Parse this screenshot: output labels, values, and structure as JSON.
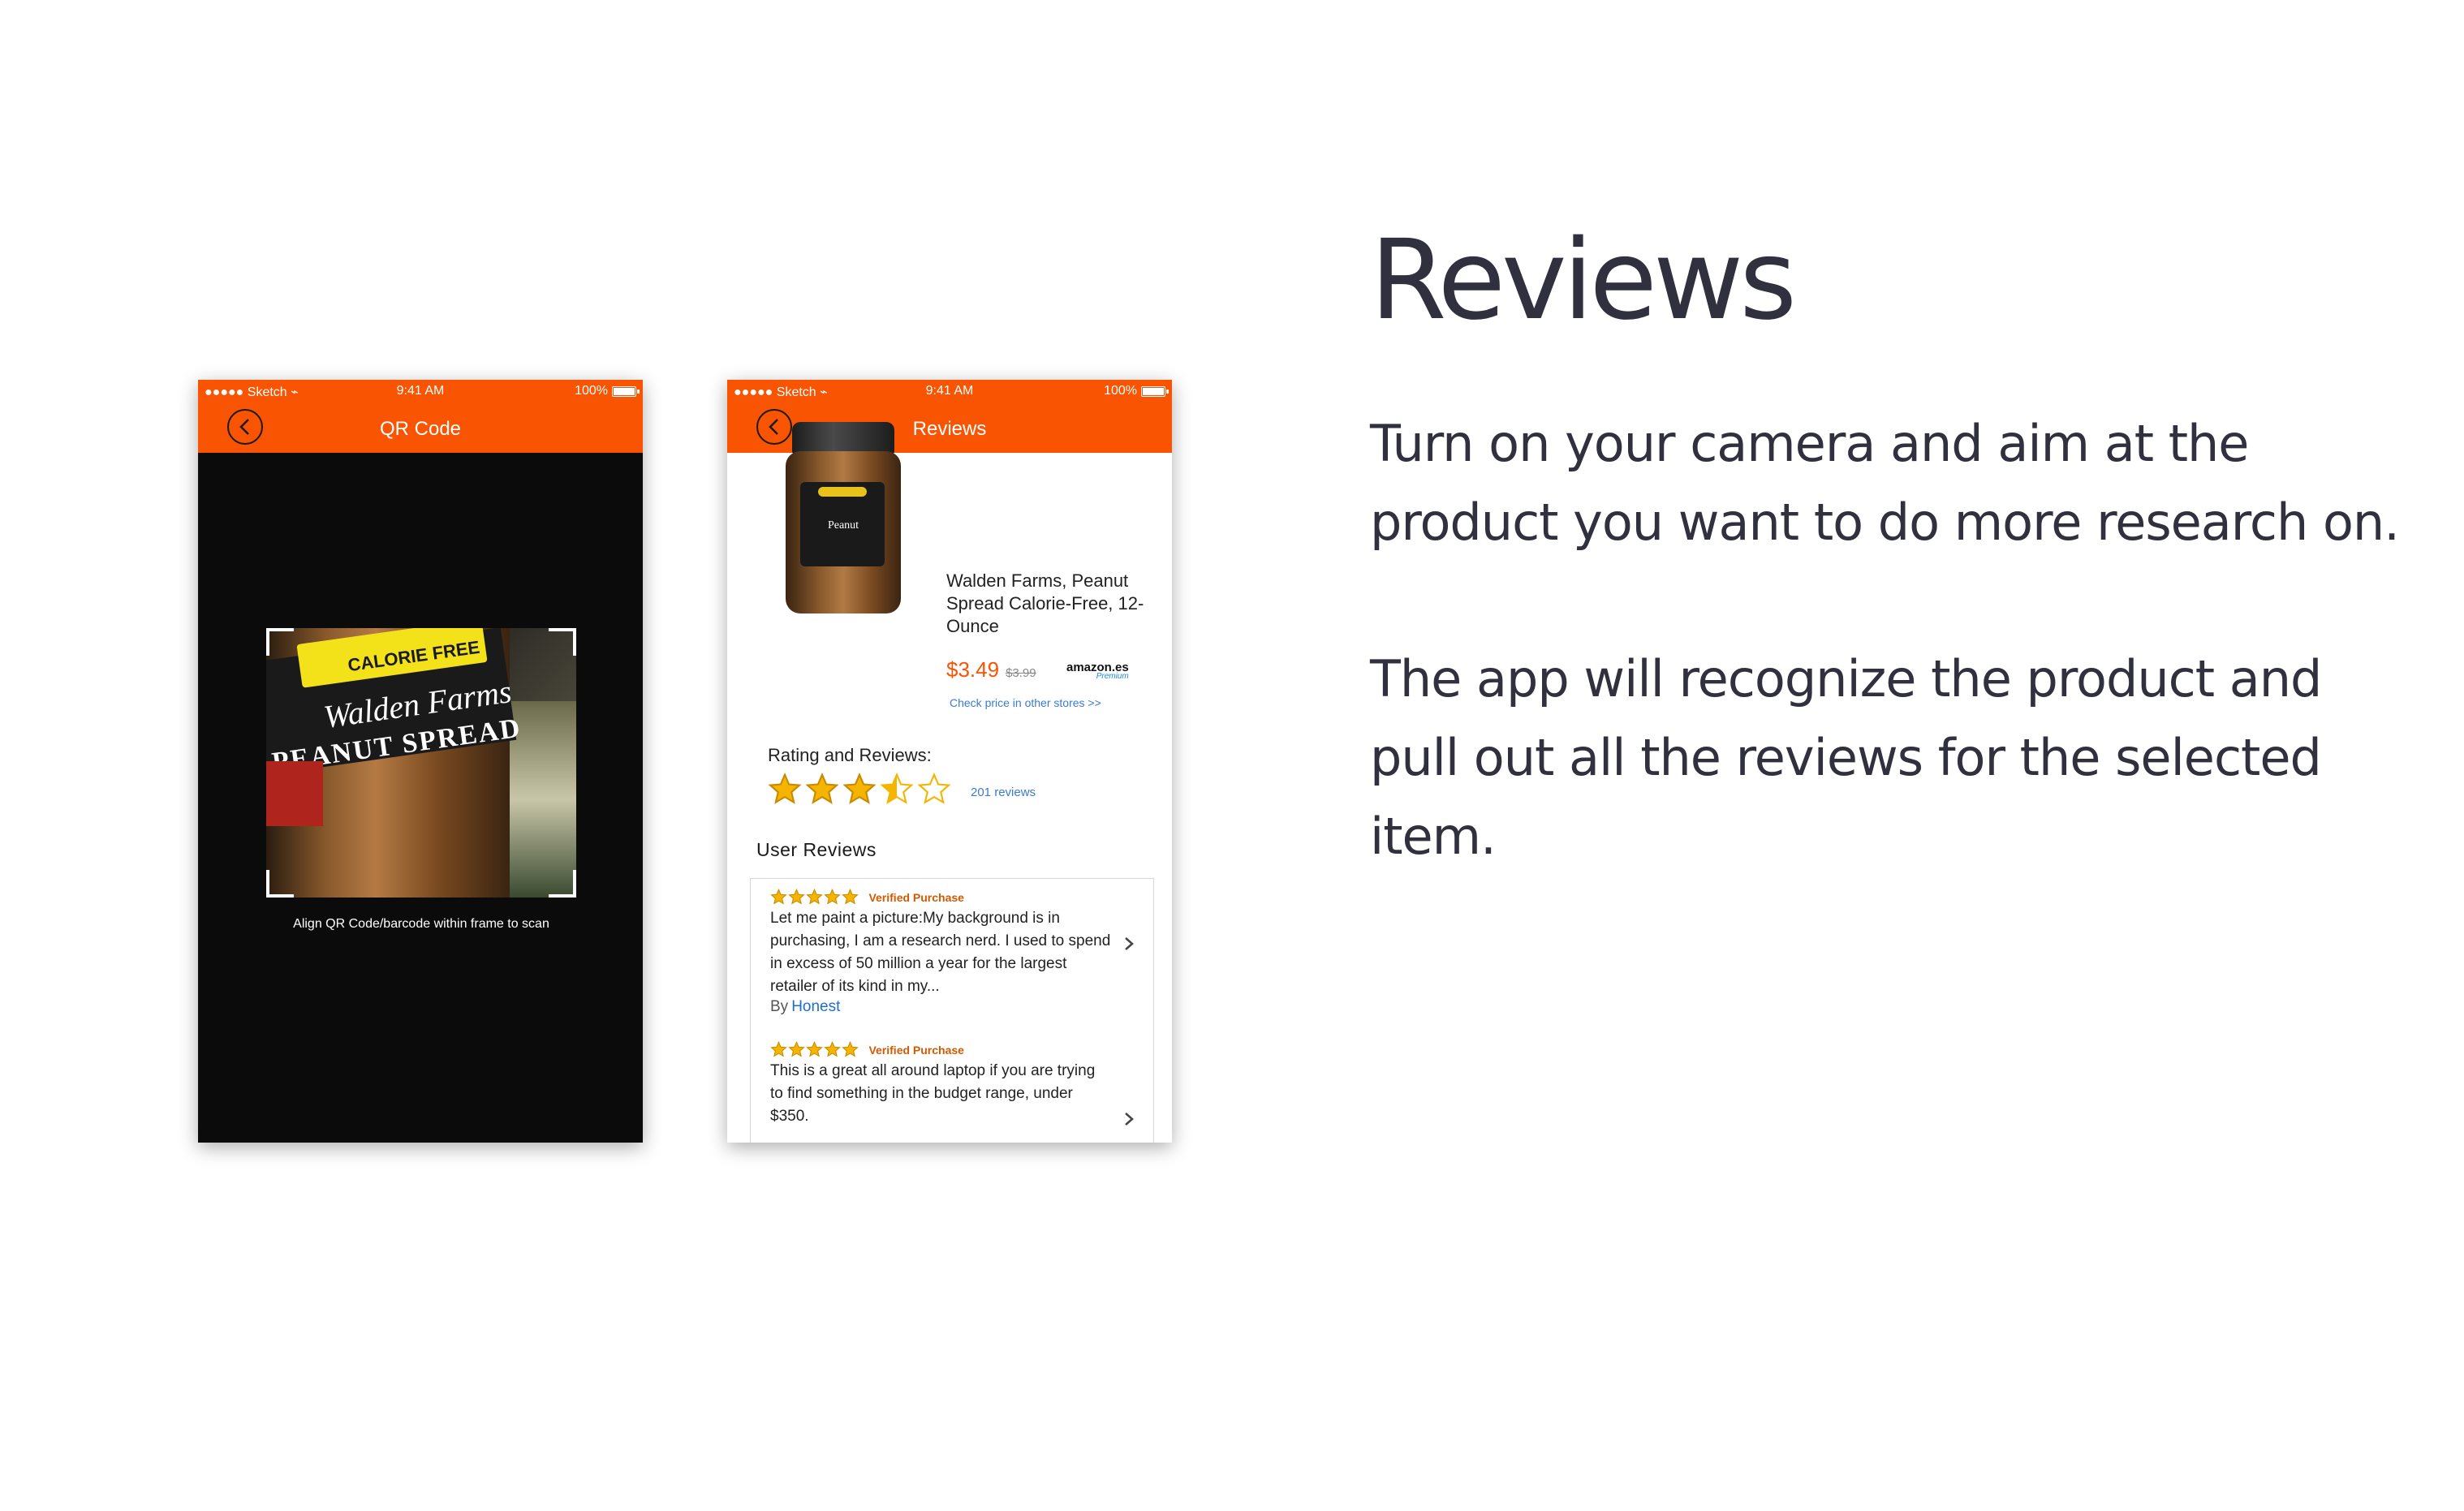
{
  "copy": {
    "title": "Reviews",
    "paragraph1": "Turn on your camera and aim at the product you want to do more research on.",
    "paragraph2": "The app will recognize the product and pull out all the reviews for the selected item."
  },
  "status_bar": {
    "carrier": "●●●●● Sketch ⌁",
    "time": "9:41 AM",
    "battery": "100%"
  },
  "scanner_screen": {
    "title": "QR Code",
    "hint": "Align QR Code/barcode within frame to scan",
    "photo_text": {
      "top": "CALORIE FREE",
      "brand": "Walden Farms",
      "product": "PEANUT SPREAD"
    }
  },
  "reviews_screen": {
    "title": "Reviews",
    "jar_label": "Peanut",
    "product_name": "Walden Farms, Peanut Spread Calorie-Free, 12-Ounce",
    "price": "$3.49",
    "old_price": "$3.99",
    "store": "amazon.es",
    "store_tag": "Premium",
    "check_price": "Check price in other stores >>",
    "rating_label": "Rating and Reviews:",
    "rating": 3.5,
    "reviews_count": "201 reviews",
    "user_reviews_title": "User Reviews",
    "reviews": [
      {
        "stars": 5,
        "badge": "Verified Purchase",
        "text": "Let me paint a picture:My background is in purchasing, I am a research nerd. I used to spend in excess of 50 million a year for the largest retailer of its kind in my...",
        "by_label": "By",
        "author": "Honest"
      },
      {
        "stars": 5,
        "badge": "Verified Purchase",
        "text": "This is a great all around laptop if you are trying to find something in the budget range, under $350."
      }
    ]
  },
  "colors": {
    "accent": "#f95402",
    "link": "#3a7bd5",
    "star": "#f5b400"
  }
}
